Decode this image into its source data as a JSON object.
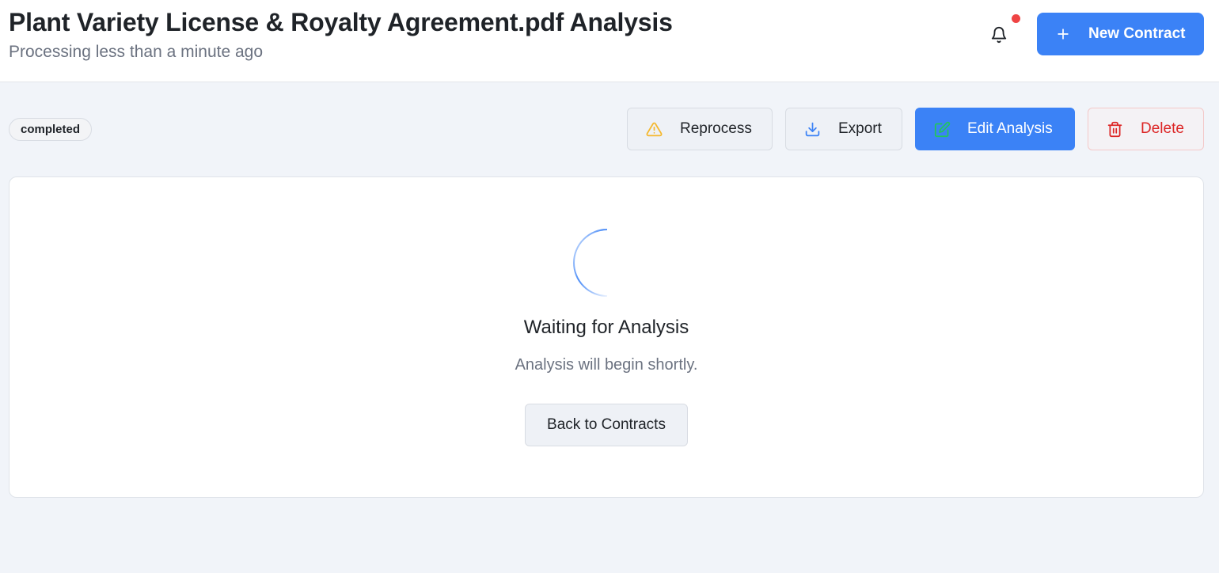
{
  "header": {
    "title": "Plant Variety License & Royalty Agreement.pdf Analysis",
    "subtitle": "Processing less than a minute ago",
    "new_contract_label": "New Contract",
    "has_notification": true
  },
  "status": {
    "badge": "completed"
  },
  "actions": {
    "reprocess": "Reprocess",
    "export": "Export",
    "edit": "Edit Analysis",
    "delete": "Delete"
  },
  "main": {
    "title": "Waiting for Analysis",
    "message": "Analysis will begin shortly.",
    "back_label": "Back to Contracts"
  },
  "icons": {
    "bell": "bell-icon",
    "plus": "plus-icon",
    "reprocess": "warning-triangle-icon",
    "export": "download-icon",
    "edit": "edit-square-icon",
    "delete": "trash-icon",
    "loading": "spinner-icon"
  },
  "colors": {
    "primary": "#3b82f6",
    "danger": "#dc2626",
    "warning": "#f5b82e",
    "success": "#22c55e",
    "notification_dot": "#ef4444",
    "background": "#f1f4f9"
  }
}
